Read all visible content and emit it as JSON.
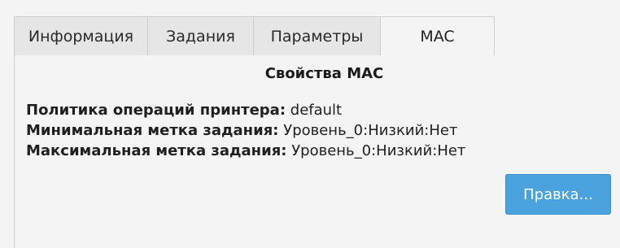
{
  "tabs": [
    {
      "label": "Информация"
    },
    {
      "label": "Задания"
    },
    {
      "label": "Параметры"
    },
    {
      "label": "MAC"
    }
  ],
  "section": {
    "title": "Свойства MAC"
  },
  "properties": [
    {
      "label": "Политика операций принтера:",
      "value": "default"
    },
    {
      "label": "Минимальная метка задания:",
      "value": "Уровень_0:Низкий:Нет"
    },
    {
      "label": "Максимальная метка задания:",
      "value": "Уровень_0:Низкий:Нет"
    }
  ],
  "buttons": {
    "edit_label": "Правка..."
  },
  "colors": {
    "accent": "#4aa3df"
  }
}
